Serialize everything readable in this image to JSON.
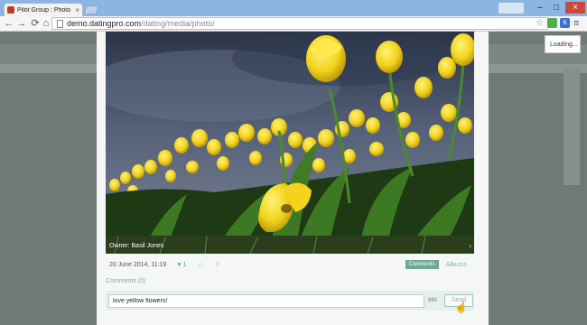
{
  "browser": {
    "tab_title": "Pilot Group : Photo galler",
    "tab_close": "×",
    "url_host": "demo.datingpro.com",
    "url_path": "/dating/media/photo/",
    "minimize": "–",
    "maximize": "□",
    "close": "×",
    "ext_label": "6"
  },
  "site": {
    "loading_text": "Loading..."
  },
  "photo_viewer": {
    "owner_label": "Owner:",
    "owner_name": "Basil Jones",
    "date": "20 June 2014, 11:19",
    "likes": "1",
    "tab_comments": "Comments",
    "tab_albums": "Albums"
  },
  "comments": {
    "label": "Comments (0)",
    "input_value": "love yellow flowers!",
    "counter": "980",
    "send_label": "Send"
  },
  "colors": {
    "accent": "#6fa896",
    "tab_strip": "#8bb6e4",
    "overlay": "#6f7a77"
  }
}
